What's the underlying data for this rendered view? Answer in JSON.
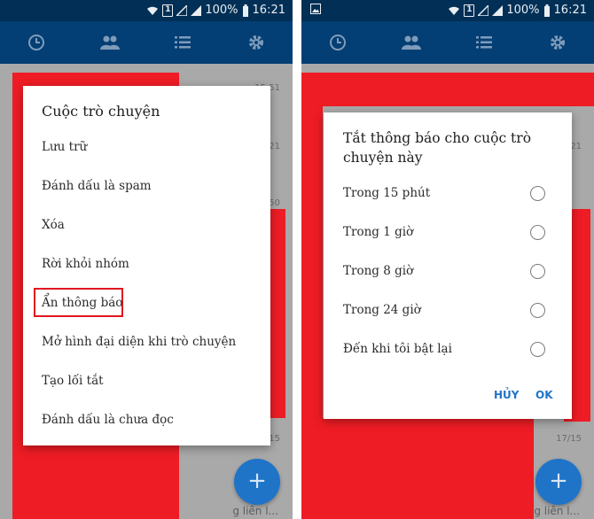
{
  "status_bar": {
    "battery": "100%",
    "time": "16:21",
    "sim_label": "1"
  },
  "app_bar": {
    "tabs": [
      "recent-clock-icon",
      "contacts-icon",
      "list-icon",
      "settings-gear-icon"
    ]
  },
  "colors": {
    "primary_dark": "#022f55",
    "primary": "#033e74",
    "accent": "#1f74c8",
    "highlight": "#e0161f",
    "redaction": "#ee1c24"
  },
  "background_list": {
    "left": {
      "timestamps": [
        "15:51",
        "21",
        "50",
        "15:15"
      ],
      "bottom_snippet": "g liên l..."
    },
    "right": {
      "timestamps": [
        "15:51",
        "21",
        "17/15"
      ],
      "bottom_snippet": "g liên l..."
    },
    "fab_label": "+"
  },
  "conversation_menu": {
    "title": "Cuộc trò chuyện",
    "items": [
      "Lưu trữ",
      "Đánh dấu là spam",
      "Xóa",
      "Rời khỏi nhóm",
      "Ẩn thông báo",
      "Mở hình đại diện khi trò chuyện",
      "Tạo lối tắt",
      "Đánh dấu là chưa đọc"
    ]
  },
  "mute_dialog": {
    "title_line1": "Tắt thông báo cho cuộc trò",
    "title_line2": "chuyện này",
    "options": [
      "Trong 15 phút",
      "Trong 1 giờ",
      "Trong 8 giờ",
      "Trong 24 giờ",
      "Đến khi tôi bật lại"
    ],
    "cancel": "HỦY",
    "ok": "OK"
  }
}
